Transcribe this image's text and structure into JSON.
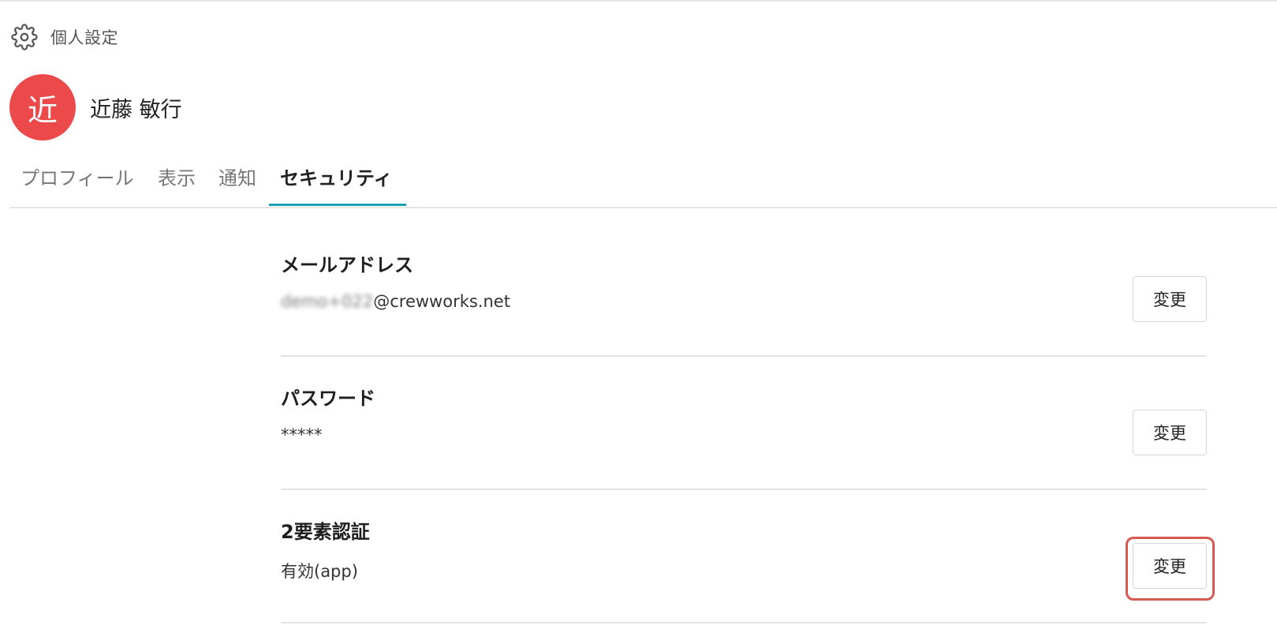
{
  "header": {
    "icon": "gear-icon",
    "title": "個人設定"
  },
  "user": {
    "avatar_text": "近",
    "avatar_color": "#ec4a4a",
    "name": "近藤 敏行"
  },
  "tabs": [
    {
      "label": "プロフィール",
      "active": false
    },
    {
      "label": "表示",
      "active": false
    },
    {
      "label": "通知",
      "active": false
    },
    {
      "label": "セキュリティ",
      "active": true
    }
  ],
  "accent_color": "#1aa3b8",
  "sections": [
    {
      "label": "メールアドレス",
      "value_blurred": "demo+022",
      "value": "@crewworks.net",
      "button_label": "変更"
    },
    {
      "label": "パスワード",
      "value": "*****",
      "button_label": "変更"
    },
    {
      "label": "2要素認証",
      "value": "有効(app)",
      "button_label": "変更",
      "highlighted": true
    }
  ],
  "highlight_color": "#d65a52"
}
